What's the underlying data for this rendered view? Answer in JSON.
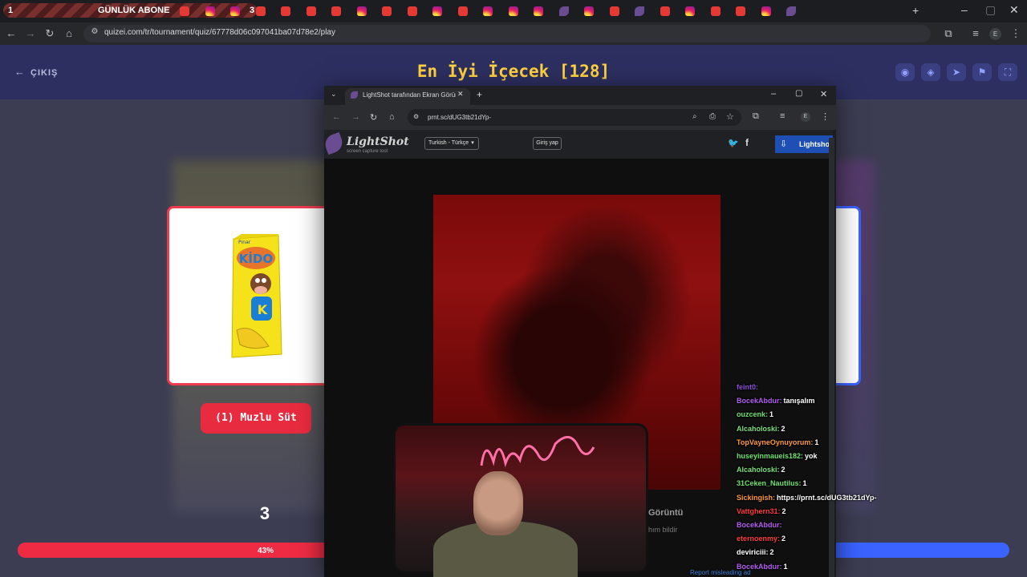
{
  "tabstrip": {
    "counter_left": "1",
    "counter_title": "GÜNLÜK ABONE",
    "counter_right": "3",
    "new_tab_label": "+"
  },
  "browser": {
    "url": "quizei.com/tr/tournament/quiz/67778d06c097041ba07d78e2/play",
    "profile_initial": "E"
  },
  "quiz": {
    "exit_label": "ÇIKIŞ",
    "title": "En İyi İçecek [128]",
    "choice_label": "(1) Muzlu Süt",
    "round_number": "3",
    "progress_text": "43%",
    "progress_fraction": 0.43,
    "colors": {
      "title": "#ffd23f",
      "left_accent": "#ef3b4e",
      "right_accent": "#3a63ff",
      "header": "#2d2f60"
    },
    "product_brand": "Pınar",
    "product_name": "KİDO",
    "product_letter": "K"
  },
  "popup": {
    "tab_title": "LightShot tarafından Ekran Görüntüsü",
    "url": "prnt.sc/dUG3tb21dYp-",
    "profile_initial": "E",
    "logo_text": "LightShot",
    "logo_sub": "screen capture tool",
    "language": "Turkish - Türkçe",
    "login_label": "Giriş yap",
    "download_label": "Lightshot",
    "caption": "Görüntü",
    "caption_sub": "hım bildir",
    "report_ad": "Report misleading ad"
  },
  "chat": [
    {
      "user": "feint0:",
      "msg": "",
      "color": "#8a4fd8"
    },
    {
      "user": "BocekAbdur:",
      "msg": "tanışalım",
      "color": "#b45ef0"
    },
    {
      "user": "ouzcenk:",
      "msg": "1",
      "color": "#6fe36f"
    },
    {
      "user": "Alcaholoski:",
      "msg": "2",
      "color": "#7de07d"
    },
    {
      "user": "TopVayneOynuyorum:",
      "msg": "1",
      "color": "#ff9a3c"
    },
    {
      "user": "huseyinmaueis182:",
      "msg": "yok",
      "color": "#6fe36f"
    },
    {
      "user": "Alcaholoski:",
      "msg": "2",
      "color": "#7de07d"
    },
    {
      "user": "31Ceken_Nautilus:",
      "msg": "1",
      "color": "#6fe36f"
    },
    {
      "user": "Sickingish:",
      "msg": "https://prnt.sc/dUG3tb21dYp-",
      "color": "#ff9a3c"
    },
    {
      "user": "Vattghern31:",
      "msg": "2",
      "color": "#ff3b3b"
    },
    {
      "user": "BocekAbdur:",
      "msg": "",
      "color": "#b45ef0"
    },
    {
      "user": "eternoenmy:",
      "msg": "2",
      "color": "#ff3b3b"
    },
    {
      "user": "deviriciii:",
      "msg": "2",
      "color": "#ffffff"
    },
    {
      "user": "BocekAbdur:",
      "msg": "1",
      "color": "#b45ef0"
    }
  ]
}
